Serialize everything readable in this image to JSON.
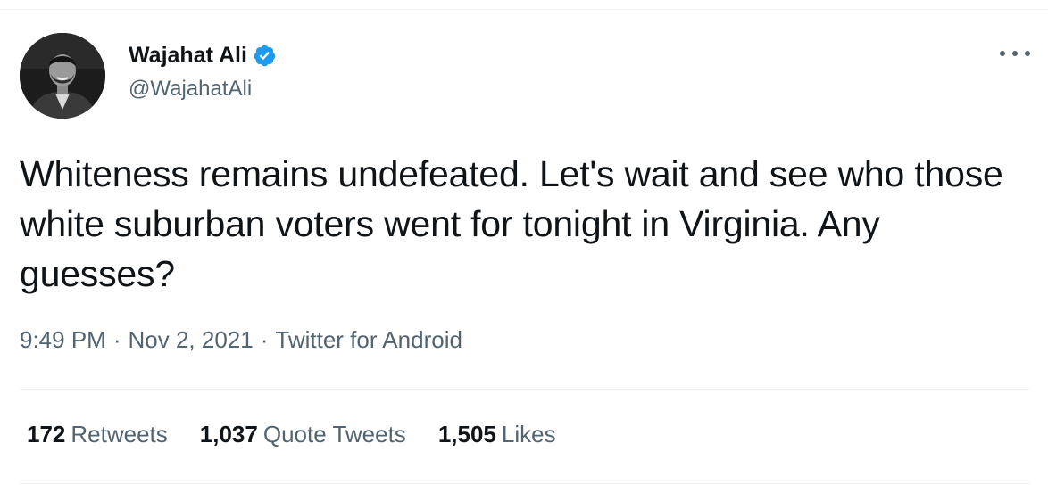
{
  "author": {
    "display_name": "Wajahat Ali",
    "handle": "@WajahatAli",
    "verified": true,
    "verified_color": "#1d9bf0"
  },
  "tweet": {
    "text": "Whiteness remains undefeated. Let's wait and see who those white suburban voters went for tonight in Virginia. Any guesses?"
  },
  "meta": {
    "time": "9:49 PM",
    "separator": "·",
    "date": "Nov 2, 2021",
    "source": "Twitter for Android"
  },
  "stats": {
    "retweets": {
      "count": "172",
      "label": "Retweets"
    },
    "quote_tweets": {
      "count": "1,037",
      "label": "Quote Tweets"
    },
    "likes": {
      "count": "1,505",
      "label": "Likes"
    }
  },
  "icons": {
    "more": "more-options-icon",
    "verified": "verified-badge-icon"
  }
}
